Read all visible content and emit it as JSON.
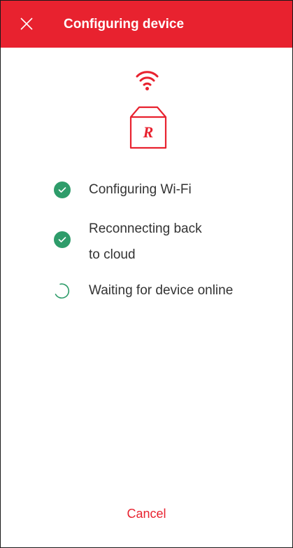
{
  "header": {
    "title": "Configuring device",
    "background": "#e8222f",
    "close_icon": "close-icon"
  },
  "device": {
    "wifi_icon": "wifi-icon",
    "device_icon": "router-device-icon",
    "device_letter": "R"
  },
  "steps": [
    {
      "label_line1": "Configuring Wi-Fi",
      "label_line2": "",
      "status": "done"
    },
    {
      "label_line1": "Reconnecting back",
      "label_line2": "to cloud",
      "status": "done"
    },
    {
      "label_line1": "Waiting for device online",
      "label_line2": "",
      "status": "in-progress"
    }
  ],
  "footer": {
    "cancel_label": "Cancel"
  },
  "colors": {
    "accent": "#e8222f",
    "success": "#2e9c6a",
    "text": "#333333"
  }
}
